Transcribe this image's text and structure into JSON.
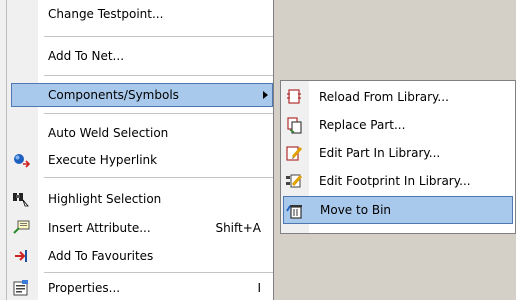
{
  "menu": {
    "items": [
      {
        "label": "Change Testpoint...",
        "icon": ""
      },
      {
        "label": "Add To Net...",
        "icon": ""
      },
      {
        "label": "Components/Symbols",
        "icon": ""
      },
      {
        "label": "Auto Weld Selection",
        "icon": ""
      },
      {
        "label": "Execute Hyperlink",
        "icon": "hyperlink-icon"
      },
      {
        "label": "Highlight Selection",
        "icon": "highlight-icon"
      },
      {
        "label": "Insert Attribute...",
        "shortcut": "Shift+A",
        "icon": "attribute-icon"
      },
      {
        "label": "Add To Favourites",
        "icon": "favourites-icon"
      },
      {
        "label": "Properties...",
        "shortcut": "I",
        "icon": "properties-icon"
      }
    ]
  },
  "submenu": {
    "items": [
      {
        "label": "Reload From Library...",
        "icon": "reload-icon"
      },
      {
        "label": "Replace Part...",
        "icon": "replace-icon"
      },
      {
        "label": "Edit Part In Library...",
        "icon": "edit-part-icon"
      },
      {
        "label": "Edit Footprint In Library...",
        "icon": "edit-footprint-icon"
      },
      {
        "label": "Move to Bin",
        "icon": "bin-icon"
      }
    ]
  },
  "colors": {
    "highlight": "#a9c9ec",
    "highlight_border": "#4f78b0",
    "gutter": "#f0f0f0"
  }
}
